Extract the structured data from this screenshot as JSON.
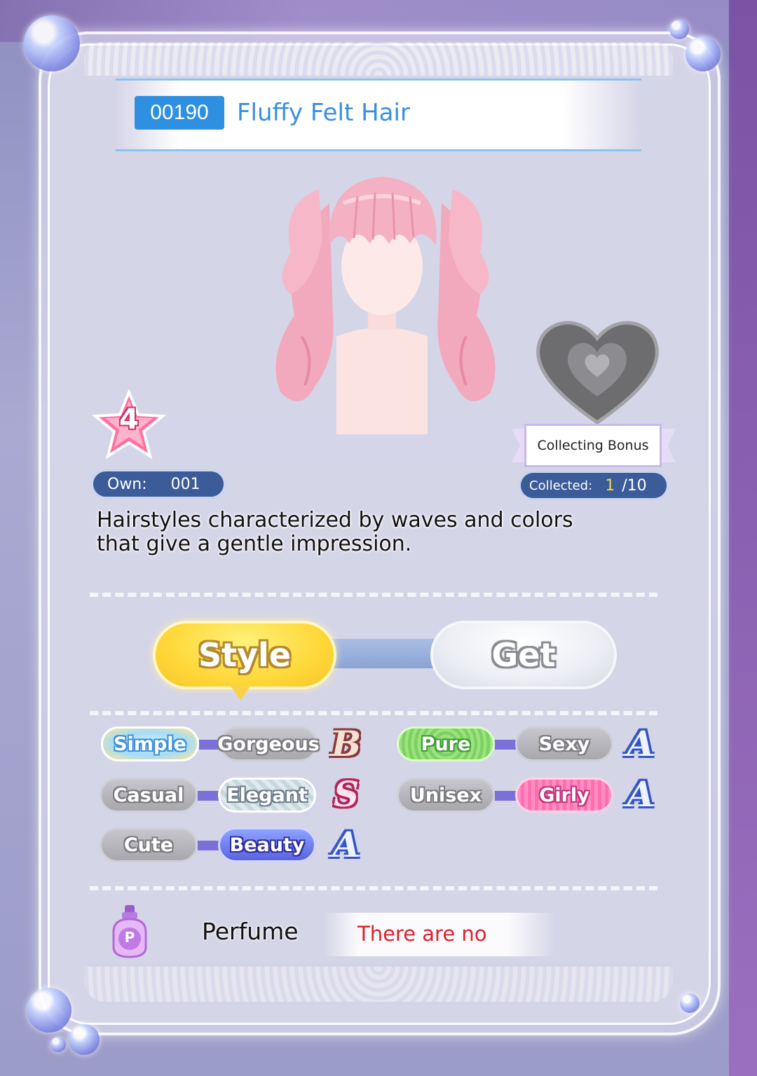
{
  "item": {
    "id": "00190",
    "name": "Fluffy Felt Hair",
    "rarity": "4",
    "own_label": "Own:",
    "own_count": "001",
    "description_line1": "Hairstyles characterized by waves and colors",
    "description_line2": "that give a gentle impression."
  },
  "collection": {
    "bonus_label": "Collecting Bonus",
    "collected_label": "Collected:",
    "collected": "1",
    "total": "/10"
  },
  "tabs": [
    {
      "label": "Style",
      "active": true
    },
    {
      "label": "Get",
      "active": false
    }
  ],
  "style_attributes": [
    {
      "left": "Simple",
      "right": "Gorgeous",
      "active_side": "left",
      "rank": "B"
    },
    {
      "left": "Pure",
      "right": "Sexy",
      "active_side": "left",
      "rank": "A"
    },
    {
      "left": "Casual",
      "right": "Elegant",
      "active_side": "right",
      "rank": "S"
    },
    {
      "left": "Unisex",
      "right": "Girly",
      "active_side": "right",
      "rank": "A"
    },
    {
      "left": "Cute",
      "right": "Beauty",
      "active_side": "right",
      "rank": "A"
    }
  ],
  "perfume": {
    "label": "Perfume",
    "icon_letter": "P",
    "value": "There are no"
  },
  "colors": {
    "accent_blue": "#2f8fe0",
    "style_tab_yellow": "#ffd83a",
    "perfume_value_red": "#e0202e"
  },
  "icons": [
    "heart-icon",
    "rarity-star-icon",
    "perfume-bottle-icon",
    "bubble-decoration-icon"
  ]
}
